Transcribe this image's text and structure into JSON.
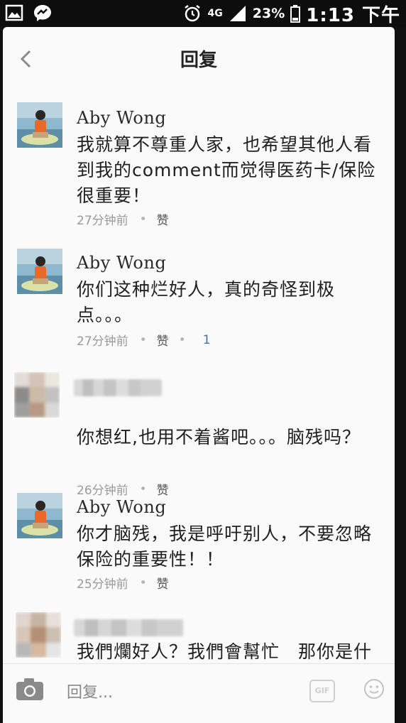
{
  "status_bar": {
    "network": "4G",
    "battery_pct": "23%",
    "time": "1:13 下午"
  },
  "header": {
    "title": "回复"
  },
  "comments": [
    {
      "name": "Aby Wong",
      "text": "我就算不尊重人家，也希望其他人看到我的comment而觉得医药卡/保险很重要！",
      "time": "27分钟前",
      "like": "赞",
      "likes": ""
    },
    {
      "name": "Aby Wong",
      "text": "你们这种烂好人，真的奇怪到极点。。。",
      "time": "27分钟前",
      "like": "赞",
      "likes": "1"
    },
    {
      "name": "",
      "text": "你想红,也用不着酱吧。。。脑残吗？",
      "time": "26分钟前",
      "like": "赞",
      "likes": ""
    },
    {
      "name": "Aby Wong",
      "text": "你才脑残，我是呼吁别人，不要忽略保险的重要性！！",
      "time": "25分钟前",
      "like": "赞",
      "likes": ""
    },
    {
      "name": "",
      "text": "我們爛好人？我們會幫忙　那你是什",
      "time": "",
      "like": "",
      "likes": ""
    }
  ],
  "composer": {
    "placeholder": "回复...",
    "gif_label": "GIF"
  },
  "icons": [
    "back-icon",
    "camera-icon",
    "gif-icon",
    "smiley-icon",
    "alarm-icon",
    "signal-icon",
    "battery-icon",
    "gallery-icon",
    "messenger-icon"
  ]
}
